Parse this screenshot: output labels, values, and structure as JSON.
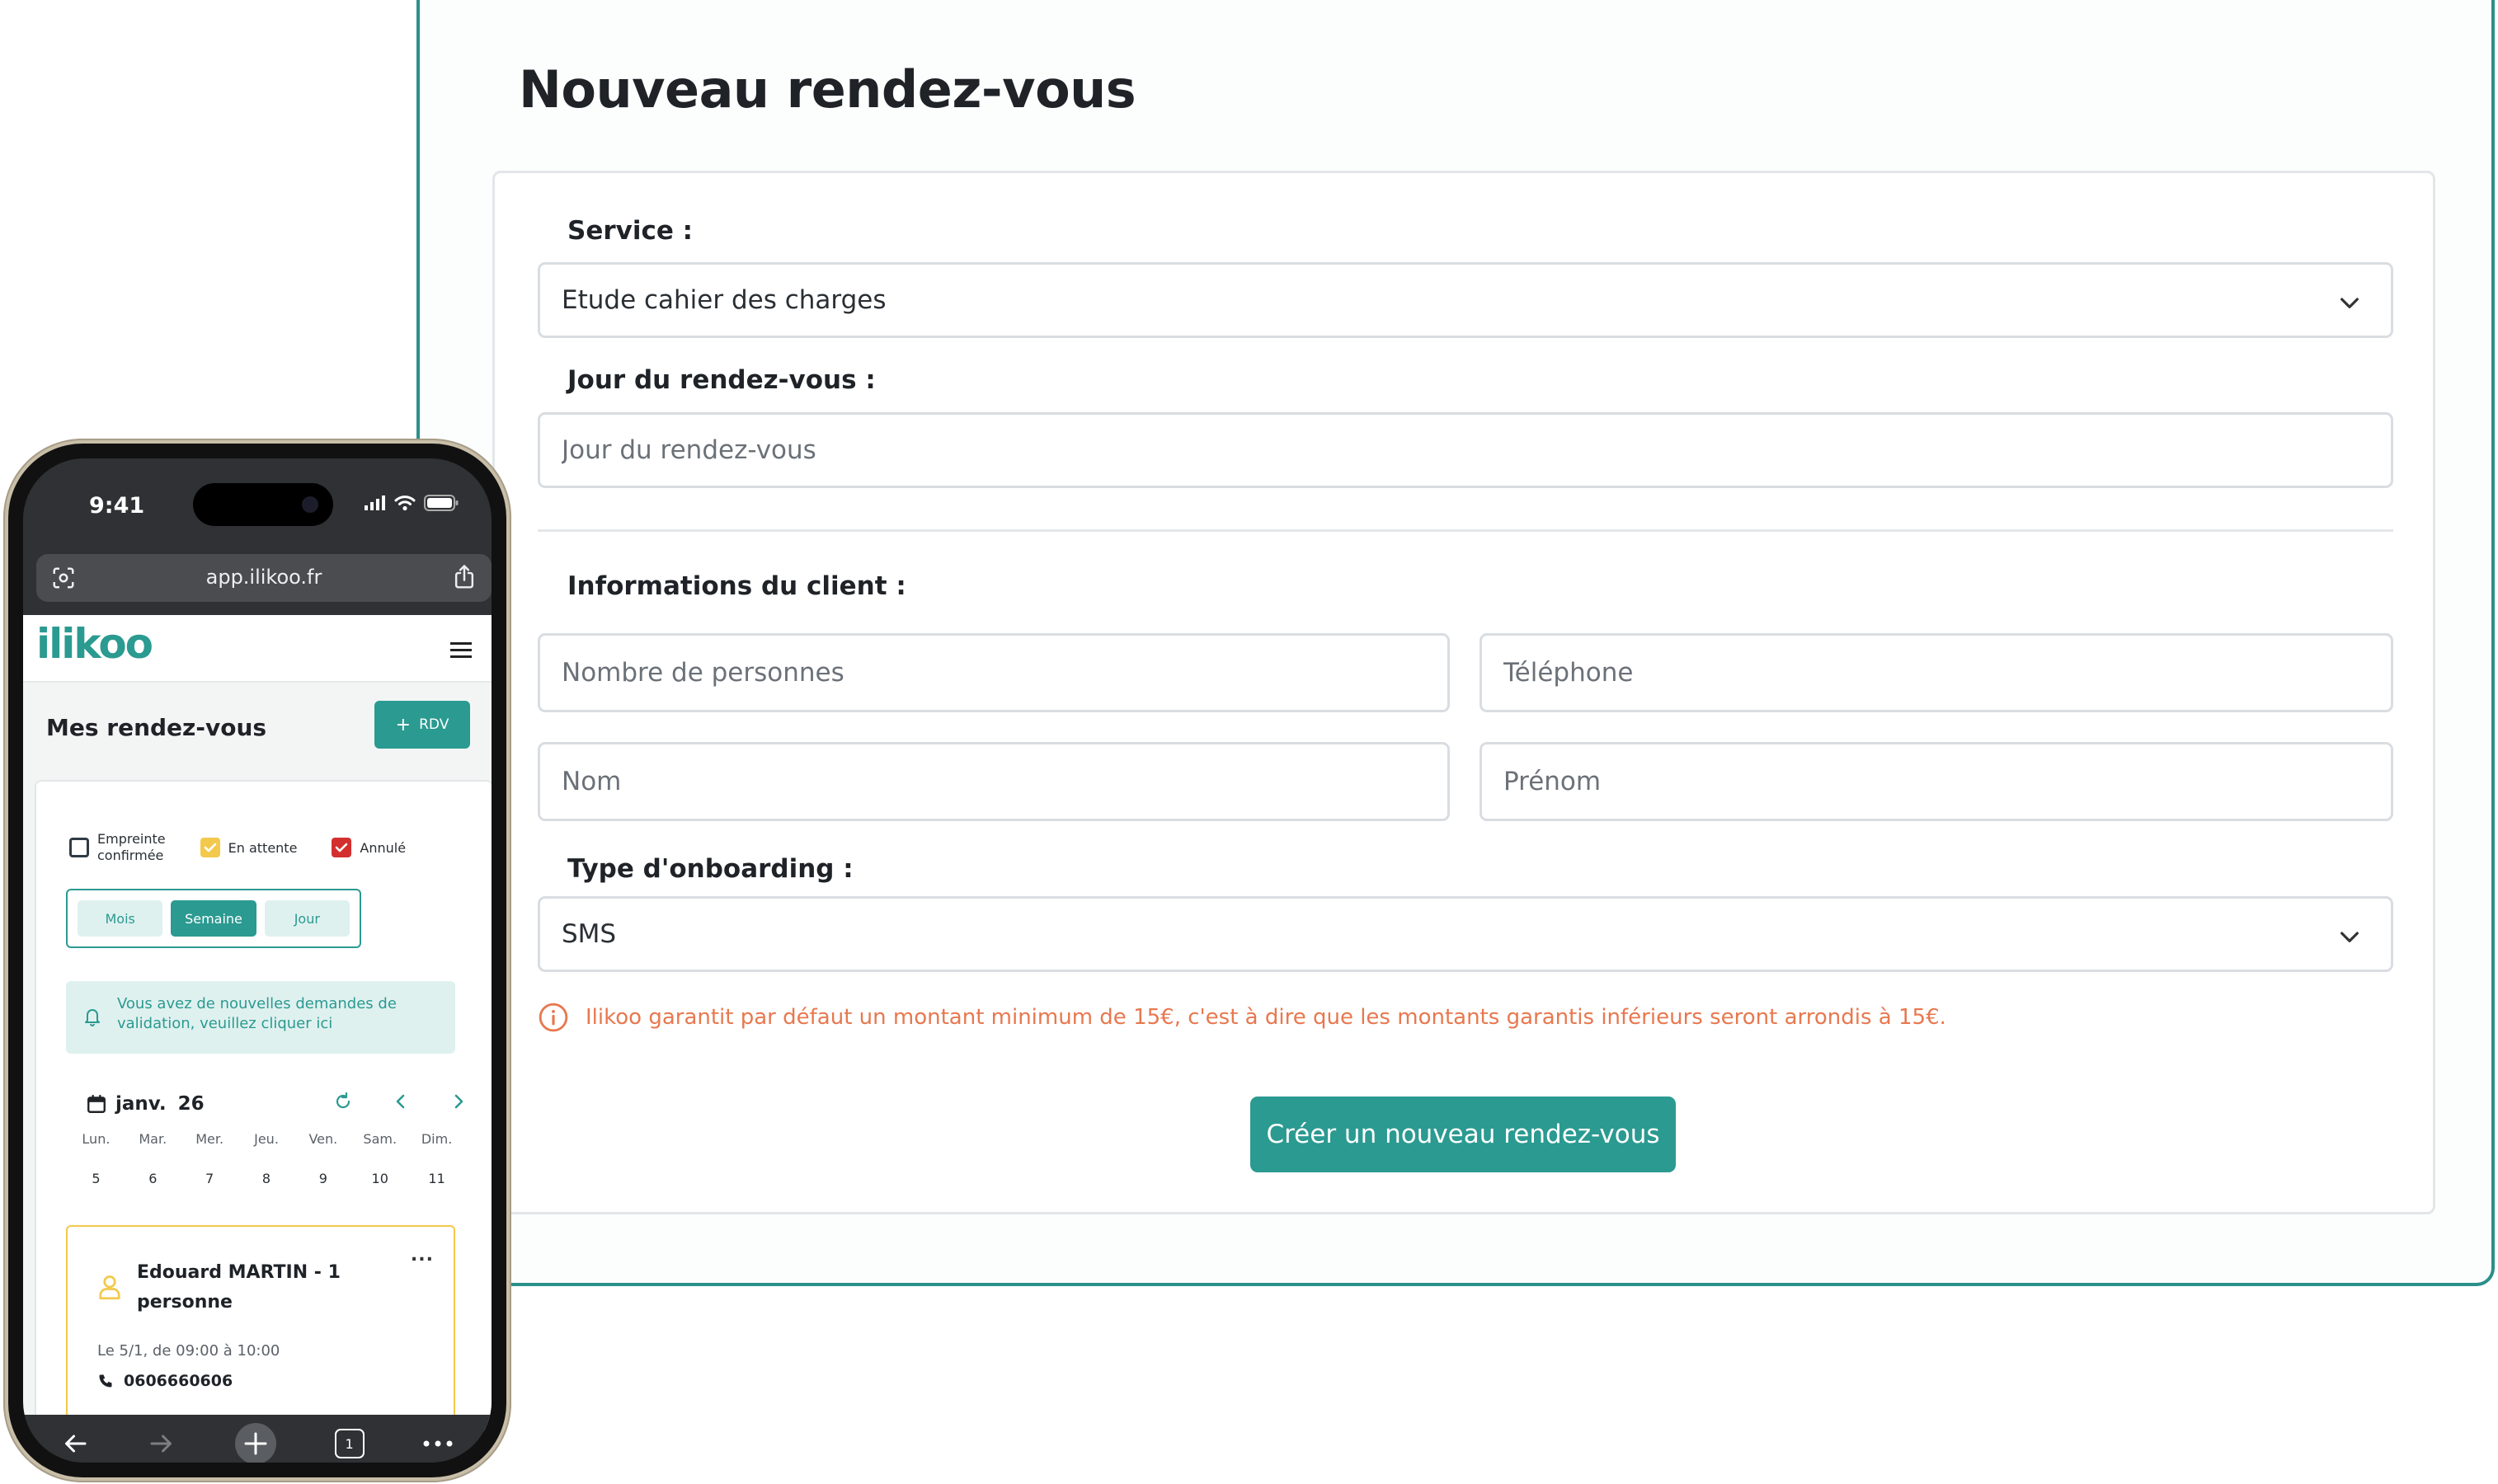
{
  "desktop": {
    "title": "Nouveau rendez-vous",
    "service_label": "Service :",
    "service_value": "Etude cahier des charges",
    "day_label": "Jour du rendez-vous :",
    "day_placeholder": "Jour du rendez-vous",
    "client_label": "Informations du client :",
    "people_placeholder": "Nombre de personnes",
    "phone_placeholder": "Téléphone",
    "lastname_placeholder": "Nom",
    "firstname_placeholder": "Prénom",
    "onboarding_label": "Type d'onboarding :",
    "onboarding_value": "SMS",
    "warning": "Ilikoo garantit par défaut un montant minimum de 15€, c'est à dire que les montants garantis inférieurs seront arrondis à 15€.",
    "submit_label": "Créer un nouveau rendez-vous"
  },
  "phone": {
    "time": "9:41",
    "url": "app.ilikoo.fr",
    "logo": "ilikoo",
    "page_title": "Mes rendez-vous",
    "rdv_button": "RDV",
    "legend": [
      {
        "label_line1": "Empreinte",
        "label_line2": "confirmée"
      },
      {
        "label": "En attente"
      },
      {
        "label": "Annulé"
      }
    ],
    "views": [
      "Mois",
      "Semaine",
      "Jour"
    ],
    "notice": "Vous avez de nouvelles demandes de validation, veuillez cliquer ici",
    "calendar": {
      "month": "janv.",
      "year": "26",
      "days": [
        "Lun.",
        "Mar.",
        "Mer.",
        "Jeu.",
        "Ven.",
        "Sam.",
        "Dim."
      ],
      "dates": [
        "5",
        "6",
        "7",
        "8",
        "9",
        "10",
        "11"
      ]
    },
    "appointment": {
      "name": "Edouard MARTIN - 1 personne",
      "dots": "...",
      "when": "Le 5/1, de 09:00 à 10:00",
      "phone": "0606660606"
    },
    "tab_count": "1"
  },
  "colors": {
    "brand": "#2b9a91",
    "warning": "#e8784f",
    "pending": "#f2c94c",
    "cancelled": "#d32f2f"
  }
}
